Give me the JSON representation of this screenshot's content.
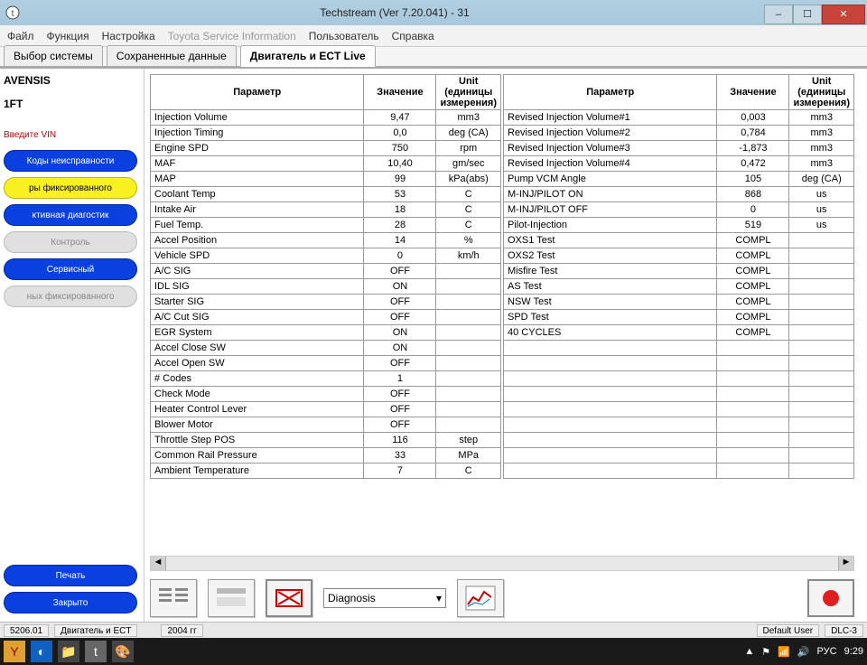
{
  "window": {
    "title": "Techstream (Ver 7.20.041) - 31",
    "min": "–",
    "max": "☐",
    "close": "✕"
  },
  "menu": {
    "file": "Файл",
    "func": "Функция",
    "settings": "Настройка",
    "tsi": "Toyota Service Information",
    "user": "Пользователь",
    "help": "Справка"
  },
  "tabs": {
    "t1": "Выбор системы",
    "t2": "Сохраненные данные",
    "t3": "Двигатель и ECT Live"
  },
  "vehicle": {
    "model": "AVENSIS",
    "variant": "1FT",
    "vin_hint": "Введите VIN"
  },
  "sidebar": {
    "b1": "Коды неисправности",
    "b2": "ры фиксированного",
    "b3": "ктивная диагостик",
    "b4": "Контроль",
    "b5": "Сервисный",
    "b6": "ных фиксированного",
    "print": "Печать",
    "close": "Закрыто"
  },
  "columns": {
    "param": "Параметр",
    "value": "Значение",
    "unit": "Unit (единицы измерения)"
  },
  "left_rows": [
    {
      "p": "Injection Volume",
      "v": "9,47",
      "u": "mm3"
    },
    {
      "p": "Injection Timing",
      "v": "0,0",
      "u": "deg (CA)"
    },
    {
      "p": "Engine SPD",
      "v": "750",
      "u": "rpm"
    },
    {
      "p": "MAF",
      "v": "10,40",
      "u": "gm/sec"
    },
    {
      "p": "MAP",
      "v": "99",
      "u": "kPa(abs)"
    },
    {
      "p": "Coolant Temp",
      "v": "53",
      "u": "C"
    },
    {
      "p": "Intake Air",
      "v": "18",
      "u": "C"
    },
    {
      "p": "Fuel Temp.",
      "v": "28",
      "u": "C"
    },
    {
      "p": "Accel Position",
      "v": "14",
      "u": "%"
    },
    {
      "p": "Vehicle SPD",
      "v": "0",
      "u": "km/h"
    },
    {
      "p": "A/C SIG",
      "v": "OFF",
      "u": ""
    },
    {
      "p": "IDL SIG",
      "v": "ON",
      "u": ""
    },
    {
      "p": "Starter SIG",
      "v": "OFF",
      "u": ""
    },
    {
      "p": "A/C Cut SIG",
      "v": "OFF",
      "u": ""
    },
    {
      "p": "EGR System",
      "v": "ON",
      "u": ""
    },
    {
      "p": "Accel Close SW",
      "v": "ON",
      "u": ""
    },
    {
      "p": "Accel Open SW",
      "v": "OFF",
      "u": ""
    },
    {
      "p": "# Codes",
      "v": "1",
      "u": ""
    },
    {
      "p": "Check Mode",
      "v": "OFF",
      "u": ""
    },
    {
      "p": "Heater Control Lever",
      "v": "OFF",
      "u": ""
    },
    {
      "p": "Blower Motor",
      "v": "OFF",
      "u": ""
    },
    {
      "p": "Throttle Step POS",
      "v": "116",
      "u": "step"
    },
    {
      "p": "Common Rail Pressure",
      "v": "33",
      "u": "MPa"
    },
    {
      "p": "Ambient Temperature",
      "v": "7",
      "u": "C"
    }
  ],
  "right_rows": [
    {
      "p": "Revised Injection Volume#1",
      "v": "0,003",
      "u": "mm3"
    },
    {
      "p": "Revised Injection Volume#2",
      "v": "0,784",
      "u": "mm3"
    },
    {
      "p": "Revised Injection Volume#3",
      "v": "-1,873",
      "u": "mm3"
    },
    {
      "p": "Revised Injection Volume#4",
      "v": "0,472",
      "u": "mm3"
    },
    {
      "p": "Pump VCM Angle",
      "v": "105",
      "u": "deg (CA)"
    },
    {
      "p": "M-INJ/PILOT ON",
      "v": "868",
      "u": "us"
    },
    {
      "p": "M-INJ/PILOT OFF",
      "v": "0",
      "u": "us"
    },
    {
      "p": "Pilot-Injection",
      "v": "519",
      "u": "us"
    },
    {
      "p": "OXS1 Test",
      "v": "COMPL",
      "u": ""
    },
    {
      "p": "OXS2 Test",
      "v": "COMPL",
      "u": ""
    },
    {
      "p": "Misfire Test",
      "v": "COMPL",
      "u": ""
    },
    {
      "p": "AS Test",
      "v": "COMPL",
      "u": ""
    },
    {
      "p": "NSW Test",
      "v": "COMPL",
      "u": ""
    },
    {
      "p": "SPD Test",
      "v": "COMPL",
      "u": ""
    },
    {
      "p": "40 CYCLES",
      "v": "COMPL",
      "u": ""
    },
    {
      "p": "",
      "v": "",
      "u": ""
    },
    {
      "p": "",
      "v": "",
      "u": ""
    },
    {
      "p": "",
      "v": "",
      "u": ""
    },
    {
      "p": "",
      "v": "",
      "u": ""
    },
    {
      "p": "",
      "v": "",
      "u": ""
    },
    {
      "p": "",
      "v": "",
      "u": ""
    },
    {
      "p": "",
      "v": "",
      "u": ""
    },
    {
      "p": "",
      "v": "",
      "u": ""
    },
    {
      "p": "",
      "v": "",
      "u": ""
    }
  ],
  "bottom_dropdown": "Diagnosis",
  "status": {
    "s1": "5206.01",
    "s2": "Двигатель и ECT",
    "s3": "2004 гг",
    "user": "Default User",
    "dlc": "DLC-3"
  },
  "taskbar": {
    "lang": "РУС",
    "time": "9:29"
  }
}
